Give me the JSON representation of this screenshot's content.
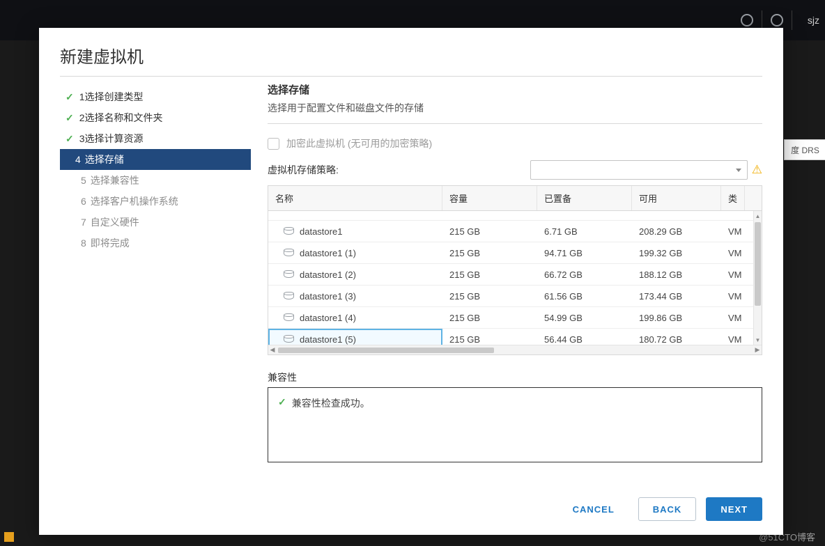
{
  "background": {
    "user_text": "sjz",
    "side_tab": "度 DRS"
  },
  "watermark": "@51CTO博客",
  "modal": {
    "title": "新建虚拟机",
    "nav": [
      {
        "num": "1",
        "label": "选择创建类型",
        "state": "done"
      },
      {
        "num": "2",
        "label": "选择名称和文件夹",
        "state": "done"
      },
      {
        "num": "3",
        "label": "选择计算资源",
        "state": "done"
      },
      {
        "num": "4",
        "label": "选择存储",
        "state": "active"
      },
      {
        "num": "5",
        "label": "选择兼容性",
        "state": "future"
      },
      {
        "num": "6",
        "label": "选择客户机操作系统",
        "state": "future"
      },
      {
        "num": "7",
        "label": "自定义硬件",
        "state": "future"
      },
      {
        "num": "8",
        "label": "即将完成",
        "state": "future"
      }
    ],
    "section": {
      "title": "选择存储",
      "desc": "选择用于配置文件和磁盘文件的存储"
    },
    "encrypt_label": "加密此虚拟机 (无可用的加密策略)",
    "policy_label": "虚拟机存储策略:",
    "table": {
      "headers": {
        "name": "名称",
        "capacity": "容量",
        "provisioned": "已置备",
        "free": "可用",
        "type": "类"
      },
      "rows": [
        {
          "name": "datastore1",
          "capacity": "215 GB",
          "provisioned": "6.71 GB",
          "free": "208.29 GB",
          "type": "VM",
          "selected": false
        },
        {
          "name": "datastore1 (1)",
          "capacity": "215 GB",
          "provisioned": "94.71 GB",
          "free": "199.32 GB",
          "type": "VM",
          "selected": false
        },
        {
          "name": "datastore1 (2)",
          "capacity": "215 GB",
          "provisioned": "66.72 GB",
          "free": "188.12 GB",
          "type": "VM",
          "selected": false
        },
        {
          "name": "datastore1 (3)",
          "capacity": "215 GB",
          "provisioned": "61.56 GB",
          "free": "173.44 GB",
          "type": "VM",
          "selected": false
        },
        {
          "name": "datastore1 (4)",
          "capacity": "215 GB",
          "provisioned": "54.99 GB",
          "free": "199.86 GB",
          "type": "VM",
          "selected": false
        },
        {
          "name": "datastore1 (5)",
          "capacity": "215 GB",
          "provisioned": "56.44 GB",
          "free": "180.72 GB",
          "type": "VM",
          "selected": true
        }
      ]
    },
    "compat_label": "兼容性",
    "compat_msg": "兼容性检查成功。",
    "buttons": {
      "cancel": "CANCEL",
      "back": "BACK",
      "next": "NEXT"
    }
  }
}
